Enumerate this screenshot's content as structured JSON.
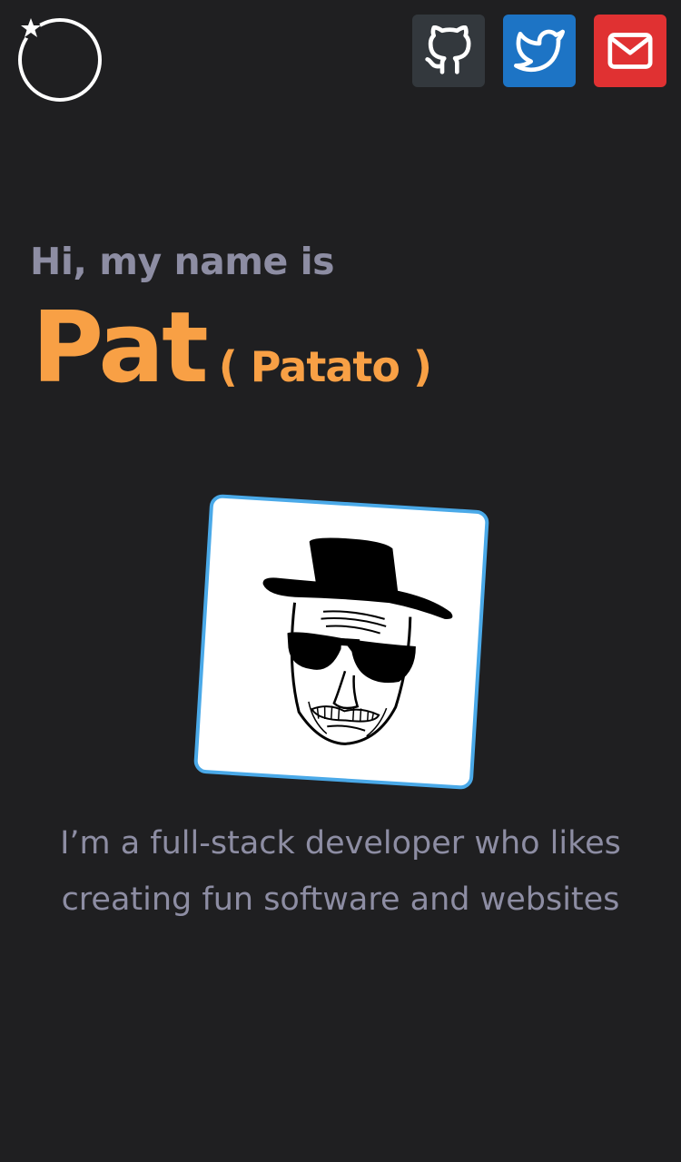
{
  "header": {
    "logo_icon": "circle-star-logo-icon",
    "social": [
      {
        "name": "github",
        "icon": "github-icon",
        "color": "#33383d"
      },
      {
        "name": "twitter",
        "icon": "twitter-icon",
        "color": "#1d74c5"
      },
      {
        "name": "email",
        "icon": "mail-icon",
        "color": "#e03132"
      }
    ]
  },
  "hero": {
    "greeting": "Hi, my name is",
    "name": "Pat",
    "nickname": "( Patato )",
    "avatar_icon": "heisenberg-portrait-icon",
    "bio_line1": "I’m a full-stack developer who likes",
    "bio_line2": "creating fun software and websites"
  },
  "colors": {
    "background": "#1f1f21",
    "accent": "#f8a045",
    "muted_text": "#8d8da3",
    "avatar_border": "#4aa9e8"
  }
}
